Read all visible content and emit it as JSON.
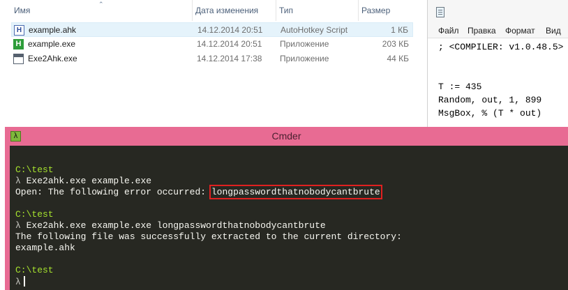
{
  "explorer": {
    "columns": {
      "name": "Имя",
      "date": "Дата изменения",
      "type": "Тип",
      "size": "Размер"
    },
    "files": [
      {
        "icon": "ahk-script-icon",
        "name": "example.ahk",
        "date": "14.12.2014 20:51",
        "type": "AutoHotkey Script",
        "size": "1 КБ"
      },
      {
        "icon": "exe-app-icon",
        "name": "example.exe",
        "date": "14.12.2014 20:51",
        "type": "Приложение",
        "size": "203 КБ"
      },
      {
        "icon": "window-app-icon",
        "name": "Exe2Ahk.exe",
        "date": "14.12.2014 17:38",
        "type": "Приложение",
        "size": "44 КБ"
      }
    ]
  },
  "notepad": {
    "menu": {
      "file": "Файл",
      "edit": "Правка",
      "format": "Формат",
      "view": "Вид"
    },
    "lines": {
      "line1": "; <COMPILER: v1.0.48.5>",
      "line2": "T := 435",
      "line3": "Random, out, 1, 899",
      "line4": "MsgBox, % (T * out)"
    }
  },
  "cmder": {
    "title": "Cmder",
    "lambda": "λ",
    "terminal": {
      "prompt1": "C:\\test",
      "cmd1": " Exe2ahk.exe example.exe",
      "err_prefix": "Open: The following error occurred: ",
      "err_value": "longpasswordthatnobodycantbrute",
      "prompt2": "C:\\test",
      "cmd2": " Exe2ahk.exe example.exe longpasswordthatnobodycantbrute",
      "out1": "The following file was successfully extracted to the current directory:",
      "out2": "example.ahk",
      "prompt3": "C:\\test"
    }
  }
}
